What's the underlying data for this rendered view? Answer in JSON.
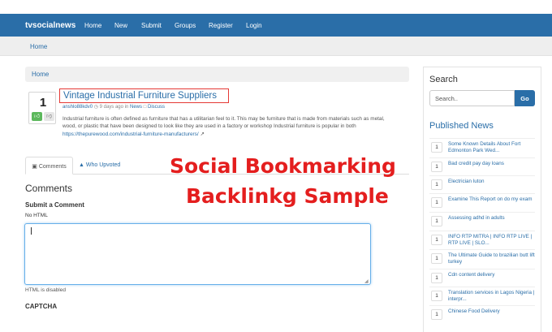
{
  "navbar": {
    "brand": "tvsocialnews",
    "items": [
      "Home",
      "New",
      "Submit",
      "Groups",
      "Register",
      "Login"
    ]
  },
  "subbar": {
    "home": "Home"
  },
  "breadcrumb": {
    "home": "Home"
  },
  "story": {
    "votes": "1",
    "up_icon": "thumbs-up-icon",
    "down_icon": "thumbs-down-icon",
    "title": "Vintage Industrial Furniture Suppliers",
    "author": "anshlo88kdv0",
    "time": "9 days ago",
    "in_label": "in",
    "category": "News",
    "discuss": "Discuss",
    "description": "Industrial furniture is often defined as furniture that has a utilitarian feel to it. This may be furniture that is made from materials such as metal, wood, or plastic that have been designed to look like they are used in a factory or workshop  Industrial furniture is popular in both ",
    "link": "https://thepurewood.com/industrial-furniture-manufacturers/"
  },
  "tabs": {
    "comments": "Comments",
    "upvoted": "Who Upvoted"
  },
  "overlay": {
    "line1": "Social Bookmarking",
    "line2": "Backlinkg Sample"
  },
  "comments": {
    "heading": "Comments",
    "submit_heading": "Submit a Comment",
    "no_html": "No HTML",
    "html_disabled": "HTML is disabled",
    "captcha": "CAPTCHA"
  },
  "sidebar": {
    "search_heading": "Search",
    "search_placeholder": "Search..",
    "go": "Go",
    "published_heading": "Published News",
    "news": [
      {
        "count": "1",
        "title": "Some Known Details About Fort Edmonton Park Wed..."
      },
      {
        "count": "1",
        "title": "Bad credit pay day loans"
      },
      {
        "count": "1",
        "title": "Electrician luton"
      },
      {
        "count": "1",
        "title": "Examine This Report on do my exam"
      },
      {
        "count": "1",
        "title": "Assessing adhd in adults"
      },
      {
        "count": "1",
        "title": "INFO RTP MITRA | INFO RTP LIVE | RTP LIVE | SLO..."
      },
      {
        "count": "1",
        "title": "The Ultimate Guide to brazilian butt lift turkey"
      },
      {
        "count": "1",
        "title": "Cdn content delivery"
      },
      {
        "count": "1",
        "title": "Translation services in Lagos Nigeria | interpr..."
      },
      {
        "count": "1",
        "title": "Chinese Food Delivery"
      }
    ]
  },
  "colors": {
    "brand": "#2a6ea8",
    "overlay": "#e41e1e",
    "upvote": "#5cb85c"
  }
}
